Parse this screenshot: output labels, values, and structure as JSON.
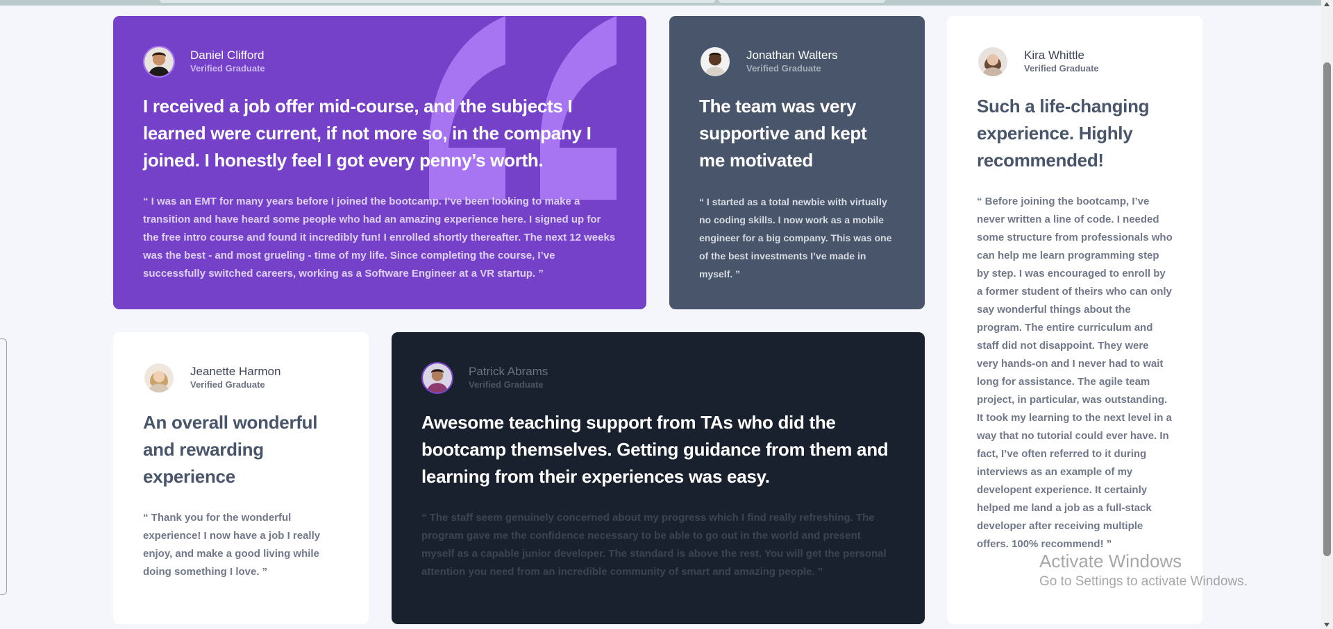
{
  "testimonials": [
    {
      "name": "Daniel Clifford",
      "badge": "Verified Graduate",
      "headline": "I received a job offer mid-course, and the subjects I learned were current, if not more so, in the company I joined. I honestly feel I got every penny’s worth.",
      "body": "“ I was an EMT for many years before I joined the bootcamp. I’ve been looking to make a transition and have heard some people who had an amazing experience here. I signed up for the free intro course and found it incredibly fun! I enrolled shortly thereafter. The next 12 weeks was the best - and most grueling - time of my life. Since completing the course, I’ve successfully switched careers, working as a Software Engineer at a VR startup. ”"
    },
    {
      "name": "Jonathan Walters",
      "badge": "Verified Graduate",
      "headline": "The team was very supportive and kept me motivated",
      "body": "“ I started as a total newbie with virtually no coding skills. I now work as a mobile engineer for a big company. This was one of the best investments I’ve made in myself. ”"
    },
    {
      "name": "Kira Whittle",
      "badge": "Verified Graduate",
      "headline": "Such a life-changing experience. Highly recommended!",
      "body": "“ Before joining the bootcamp, I’ve never written a line of code. I needed some structure from professionals who can help me learn programming step by step. I was encouraged to enroll by a former student of theirs who can only say wonderful things about the program. The entire curriculum and staff did not disappoint. They were very hands-on and I never had to wait long for assistance. The agile team project, in particular, was outstanding. It took my learning to the next level in a way that no tutorial could ever have. In fact, I’ve often referred to it during interviews as an example of my developent experience. It certainly helped me land a job as a full-stack developer after receiving multiple offers. 100% recommend! ”"
    },
    {
      "name": "Jeanette Harmon",
      "badge": "Verified Graduate",
      "headline": "An overall wonderful and rewarding experience",
      "body": "“ Thank you for the wonderful experience! I now have a job I really enjoy, and make a good living while doing something I love. ”"
    },
    {
      "name": "Patrick Abrams",
      "badge": "Verified Graduate",
      "headline": "Awesome teaching support from TAs who did the bootcamp themselves. Getting guidance from them and learning from their experiences was easy.",
      "body": "“ The staff seem genuinely concerned about my progress which I find really refreshing. The program gave me the confidence necessary to be able to go out in the world and present myself as a capable junior developer. The standard is above the rest. You will get the personal attention you need from an incredible community of smart and amazing people. ”"
    }
  ],
  "colors": {
    "purple": "#7541c8",
    "gray_blue": "#48556a",
    "dark": "#19212e",
    "white": "#ffffff",
    "background": "#f4f6fb"
  },
  "icons": {
    "quote": "quote-icon",
    "avatar": "avatar-icon"
  },
  "watermark": {
    "line1": "Activate Windows",
    "line2": "Go to Settings to activate Windows."
  }
}
